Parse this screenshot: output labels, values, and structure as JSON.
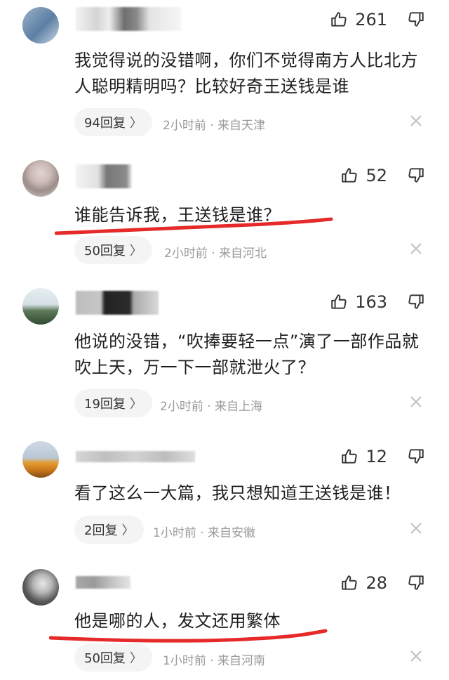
{
  "comments": [
    {
      "text": "我觉得说的没错啊，你们不觉得南方人比北方人聪明精明吗？比较好奇王送钱是谁",
      "likes": "261",
      "reply_label": "94回复",
      "meta": "2小时前 · 来自天津",
      "icons": {
        "like": "thumbs-up-icon",
        "dislike": "thumbs-down-icon",
        "close": "close-icon",
        "chevron": "chevron-right-icon"
      }
    },
    {
      "text": "谁能告诉我，王送钱是谁？",
      "likes": "52",
      "reply_label": "50回复",
      "meta": "2小时前 · 来自河北",
      "underline_color": "#e62a2a"
    },
    {
      "text": "他说的没错，“吹捧要轻一点”演了一部作品就吹上天，万一下一部就泄火了？",
      "likes": "163",
      "reply_label": "19回复",
      "meta": "2小时前 · 来自上海"
    },
    {
      "text": "看了这么一大篇，我只想知道王送钱是谁！",
      "likes": "12",
      "reply_label": "2回复",
      "meta": "1小时前 · 来自安徽"
    },
    {
      "text": "他是哪的人，发文还用繁体",
      "likes": "28",
      "reply_label": "50回复",
      "meta": "1小时前 · 来自河南",
      "underline_color": "#e62a2a"
    }
  ]
}
